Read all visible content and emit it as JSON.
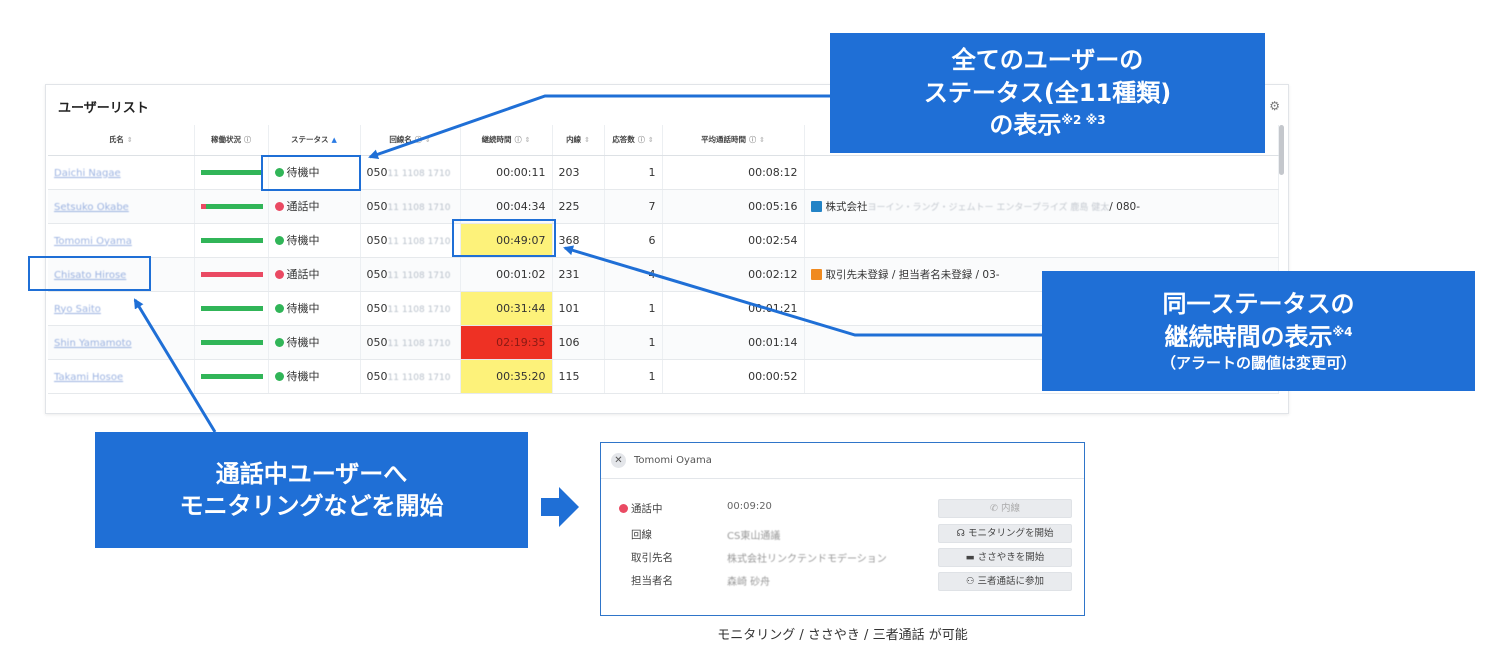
{
  "panel": {
    "title": "ユーザーリスト",
    "columns": [
      "氏名",
      "稼働状況",
      "ステータス",
      "回線名",
      "継続時間",
      "内線",
      "応答数",
      "平均通話時間",
      ""
    ],
    "rows": [
      {
        "name": "Daichi Nagae",
        "status": "待機中",
        "status_color": "green",
        "line_prefix": "050",
        "line_masked": "11 1108 1710",
        "duration": "00:00:11",
        "extension": "203",
        "answers": "1",
        "avg_time": "00:08:12",
        "memo": "",
        "memo_masked": "",
        "memo_tail": ""
      },
      {
        "name": "Setsuko Okabe",
        "status": "通話中",
        "status_color": "red",
        "line_prefix": "050",
        "line_masked": "11 1108 1710",
        "duration": "00:04:34",
        "extension": "225",
        "answers": "7",
        "avg_time": "00:05:16",
        "memo": "株式会社",
        "memo_masked": "ヨーイン・ラング・ジェムトー エンタープライズ 鹿島 健太",
        "memo_tail": "/ 080-"
      },
      {
        "name": "Tomomi Oyama",
        "status": "待機中",
        "status_color": "green",
        "line_prefix": "050",
        "line_masked": "11 1108 1710",
        "duration": "00:49:07",
        "extension": "368",
        "answers": "6",
        "avg_time": "00:02:54",
        "memo": "",
        "memo_masked": "",
        "memo_tail": ""
      },
      {
        "name": "Chisato Hirose",
        "status": "通話中",
        "status_color": "red",
        "line_prefix": "050",
        "line_masked": "11 1108 1710",
        "duration": "00:01:02",
        "extension": "231",
        "answers": "4",
        "avg_time": "00:02:12",
        "memo": "取引先未登録 / 担当者名未登録 / 03-",
        "memo_masked": "",
        "memo_tail": ""
      },
      {
        "name": "Ryo Saito",
        "status": "待機中",
        "status_color": "green",
        "line_prefix": "050",
        "line_masked": "11 1108 1710",
        "duration": "00:31:44",
        "extension": "101",
        "answers": "1",
        "avg_time": "00:01:21",
        "memo": "",
        "memo_masked": "",
        "memo_tail": ""
      },
      {
        "name": "Shin Yamamoto",
        "status": "待機中",
        "status_color": "green",
        "line_prefix": "050",
        "line_masked": "11 1108 1710",
        "duration": "02:19:35",
        "extension": "106",
        "answers": "1",
        "avg_time": "00:01:14",
        "memo": "",
        "memo_masked": "",
        "memo_tail": ""
      },
      {
        "name": "Takami Hosoe",
        "status": "待機中",
        "status_color": "green",
        "line_prefix": "050",
        "line_masked": "11 1108 1710",
        "duration": "00:35:20",
        "extension": "115",
        "answers": "1",
        "avg_time": "00:00:52",
        "memo": "",
        "memo_masked": "",
        "memo_tail": ""
      }
    ]
  },
  "callouts": {
    "top": {
      "line1": "全てのユーザーの",
      "line2": "ステータス(全11種類)",
      "line3": "の表示",
      "note": "※2 ※3"
    },
    "right": {
      "line1": "同一ステータスの",
      "line2": "継続時間の表示",
      "note": "※4",
      "line3": "（アラートの閾値は変更可）"
    },
    "left": {
      "line1": "通話中ユーザーへ",
      "line2": "モニタリングなどを開始"
    }
  },
  "dialog": {
    "user": "Tomomi Oyama",
    "status": "通話中",
    "status_time": "00:09:20",
    "fields": [
      {
        "label": "回線",
        "value": "CS東山通議"
      },
      {
        "label": "取引先名",
        "value": "株式会社リンクテンドモデーション"
      },
      {
        "label": "担当者名",
        "value": "森崎 砂舟"
      }
    ],
    "buttons": [
      "内線",
      "モニタリングを開始",
      "ささやきを開始",
      "三者通話に参加"
    ]
  },
  "caption": "モニタリング / ささやき / 三者通話 が可能",
  "colors": {
    "accent": "#1f6fd6",
    "ok": "#31b558",
    "busy": "#ea4a63",
    "warn": "#fdf27a",
    "alert": "#ee3124"
  }
}
